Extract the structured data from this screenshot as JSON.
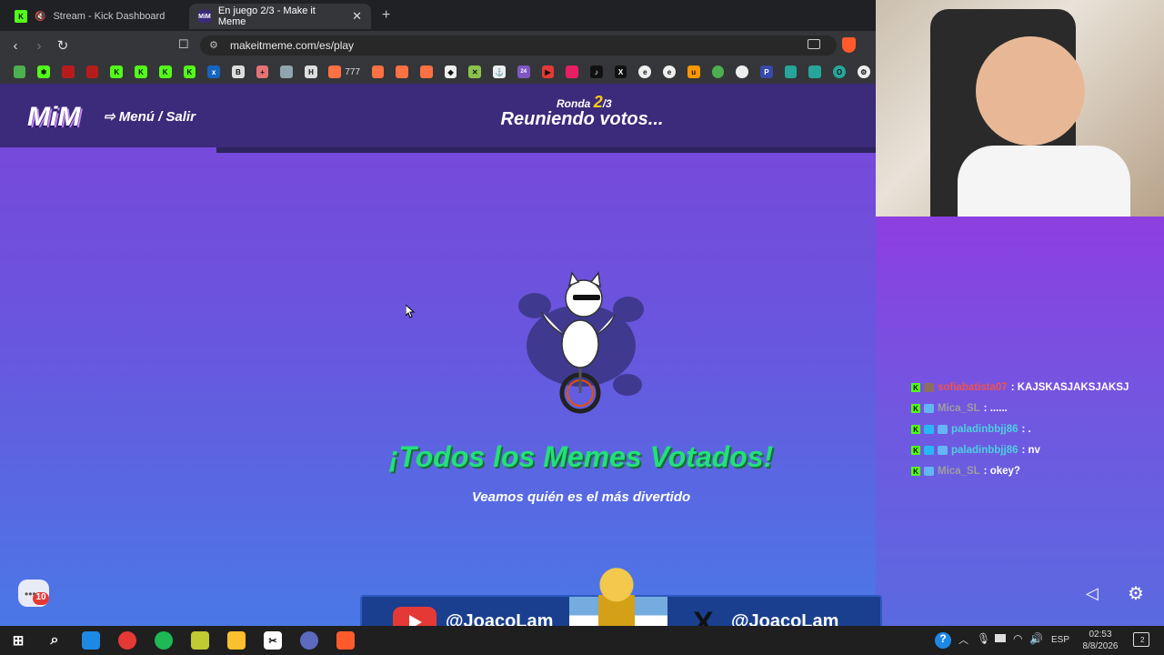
{
  "browser": {
    "tabs": [
      {
        "title": "Stream - Kick Dashboard",
        "active": false
      },
      {
        "title": "En juego 2/3 - Make it Meme",
        "active": true
      }
    ],
    "url": "makeitmeme.com/es/play",
    "bookmark_label": "777"
  },
  "game": {
    "logo": "MiM",
    "menu_label": "Menú / Salir",
    "round_label": "Ronda",
    "round_current": "2",
    "round_total": "/3",
    "status": "Reuniendo votos...",
    "headline": "¡Todos los Memes Votados!",
    "subtitle": "Veamos quién es el más divertido",
    "notification_count": "10"
  },
  "chat": {
    "messages": [
      {
        "user": "sofiabatista07",
        "text": ": KAJSKASJAKSJAKSJ",
        "color": "#ef5350"
      },
      {
        "user": "Mica_SL",
        "text": ": ......",
        "color": "#9e9e9e"
      },
      {
        "user": "paladinbbjj86",
        "text": ": .",
        "color": "#4dd0e1"
      },
      {
        "user": "paladinbbjj86",
        "text": ": nv",
        "color": "#4dd0e1"
      },
      {
        "user": "Mica_SL",
        "text": ": okey?",
        "color": "#9e9e9e"
      }
    ]
  },
  "socials": {
    "youtube": "@JoacoLam_",
    "x": "@JoacoLam"
  },
  "taskbar": {
    "language": "ESP",
    "time": "02:53",
    "date": "8/8/2026",
    "notifications": "2"
  },
  "colors": {
    "accent_green": "#22e07a",
    "kick_green": "#53fc18",
    "round_yellow": "#facc15"
  }
}
